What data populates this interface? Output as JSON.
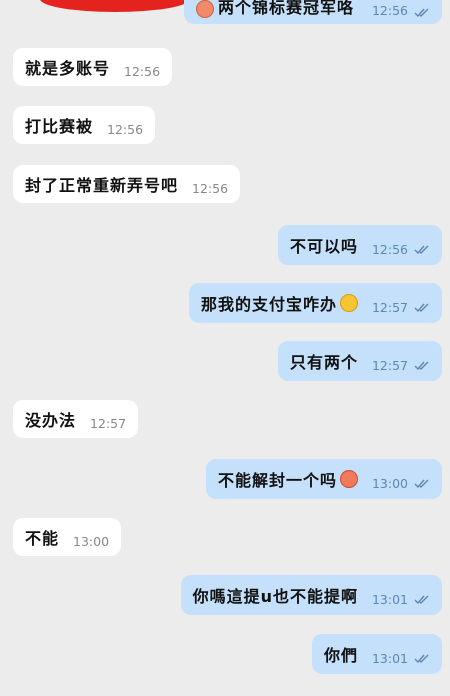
{
  "messages": [
    {
      "id": "m0",
      "dir": "out",
      "text": "两个锦标赛冠军咯",
      "time": "12:56",
      "partial": true,
      "emoji": "rose"
    },
    {
      "id": "m1",
      "dir": "in",
      "text": "就是多账号",
      "time": "12:56"
    },
    {
      "id": "m2",
      "dir": "in",
      "text": "打比赛被",
      "time": "12:56"
    },
    {
      "id": "m3",
      "dir": "in",
      "text": "封了正常重新弄号吧",
      "time": "12:56"
    },
    {
      "id": "m4",
      "dir": "out",
      "text": "不可以吗",
      "time": "12:56"
    },
    {
      "id": "m5",
      "dir": "out",
      "text": "那我的支付宝咋办",
      "time": "12:57",
      "emoji": "laugh"
    },
    {
      "id": "m6",
      "dir": "out",
      "text": "只有两个",
      "time": "12:57"
    },
    {
      "id": "m7",
      "dir": "in",
      "text": "没办法",
      "time": "12:57"
    },
    {
      "id": "m8",
      "dir": "out",
      "text": "不能解封一个吗",
      "time": "13:00",
      "emoji": "angry"
    },
    {
      "id": "m9",
      "dir": "in",
      "text": "不能",
      "time": "13:00"
    },
    {
      "id": "m10",
      "dir": "out",
      "text": "你嗎這提u也不能提啊",
      "time": "13:01"
    },
    {
      "id": "m11",
      "dir": "out",
      "text": "你們",
      "time": "13:01"
    }
  ],
  "colors": {
    "background": "#ececec",
    "incoming_bubble": "#ffffff",
    "outgoing_bubble": "#c5e0fa",
    "read_tick": "#5b87b3"
  },
  "icons": {
    "read_receipt": "double-check-icon"
  }
}
